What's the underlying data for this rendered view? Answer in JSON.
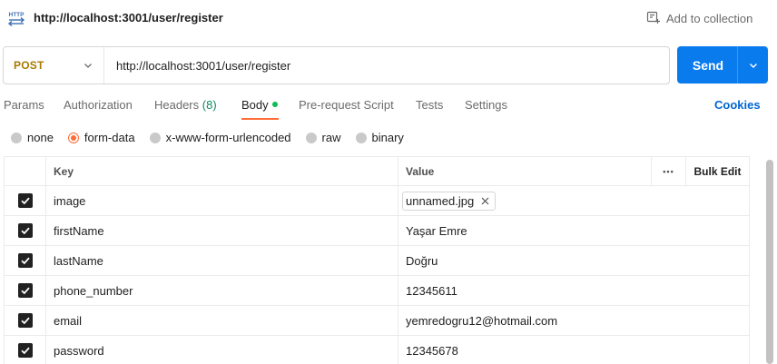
{
  "header": {
    "title": "http://localhost:3001/user/register",
    "add_to_collection": "Add to collection"
  },
  "request": {
    "method": "POST",
    "url": "http://localhost:3001/user/register",
    "send_label": "Send"
  },
  "tabs": [
    {
      "label": "Params"
    },
    {
      "label": "Authorization"
    },
    {
      "label": "Headers",
      "count": "(8)"
    },
    {
      "label": "Body"
    },
    {
      "label": "Pre-request Script"
    },
    {
      "label": "Tests"
    },
    {
      "label": "Settings"
    }
  ],
  "cookies_label": "Cookies",
  "body_types": [
    {
      "label": "none"
    },
    {
      "label": "form-data"
    },
    {
      "label": "x-www-form-urlencoded"
    },
    {
      "label": "raw"
    },
    {
      "label": "binary"
    }
  ],
  "table": {
    "key_header": "Key",
    "value_header": "Value",
    "more_label": "•••",
    "bulk_edit_label": "Bulk Edit",
    "rows": [
      {
        "key": "image",
        "value": "unnamed.jpg"
      },
      {
        "key": "firstName",
        "value": "Yaşar Emre"
      },
      {
        "key": "lastName",
        "value": "Doğru"
      },
      {
        "key": "phone_number",
        "value": "12345611"
      },
      {
        "key": "email",
        "value": "yemredogru12@hotmail.com"
      },
      {
        "key": "password",
        "value": "12345678"
      }
    ]
  },
  "colors": {
    "accent": "#ff6c37",
    "send": "#097bed",
    "method": "#a97a00",
    "link": "#0265d2"
  }
}
